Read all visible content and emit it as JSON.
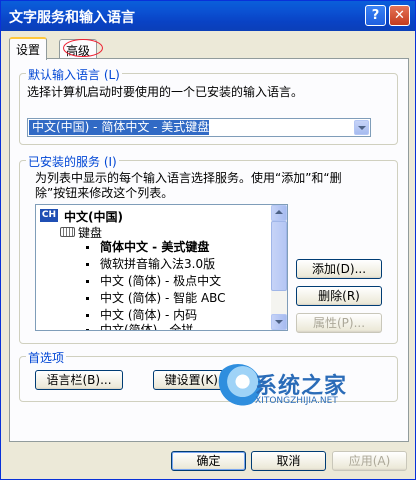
{
  "window": {
    "title": "文字服务和输入语言",
    "help_glyph": "?",
    "close_glyph": "✕"
  },
  "tabs": [
    {
      "label": "设置",
      "active": true
    },
    {
      "label": "高级",
      "active": false,
      "circled": true
    }
  ],
  "default_language": {
    "legend": "默认输入语言 (L)",
    "description": "选择计算机启动时要使用的一个已安装的输入语言。",
    "selected": "中文(中国) - 简体中文 - 美式键盘"
  },
  "installed_services": {
    "legend": "已安装的服务 (I)",
    "description_line1": "为列表中显示的每个输入语言选择服务。使用“添加”和“删",
    "description_line2": "除”按钮来修改这个列表。",
    "language_badge": "CH",
    "language_label": "中文(中国)",
    "category_label": "键盘",
    "items": [
      "简体中文 - 美式键盘",
      "微软拼音输入法3.0版",
      "中文 (简体) - 极点中文",
      "中文 (简体) - 智能 ABC",
      "中文 (简体) - 内码",
      "中文(简体) - 全拼"
    ],
    "selected_index": 0,
    "add_button": "添加(D)...",
    "remove_button": "删除(R)",
    "properties_button": "属性(P)..."
  },
  "preferences": {
    "legend": "首选项",
    "language_bar_button": "语言栏(B)...",
    "key_settings_button": "键设置(K)..."
  },
  "footer": {
    "ok": "确定",
    "cancel": "取消",
    "apply": "应用(A)"
  },
  "watermark": {
    "title": "系统之家",
    "url": "XITONGZHIJIA.NET"
  },
  "colors": {
    "titlebar": "#0b4fd1",
    "selection": "#316ac5",
    "group_legend": "#0046d5",
    "tab_highlight": "#ffc83c",
    "annotation_circle": "#ee2233"
  }
}
